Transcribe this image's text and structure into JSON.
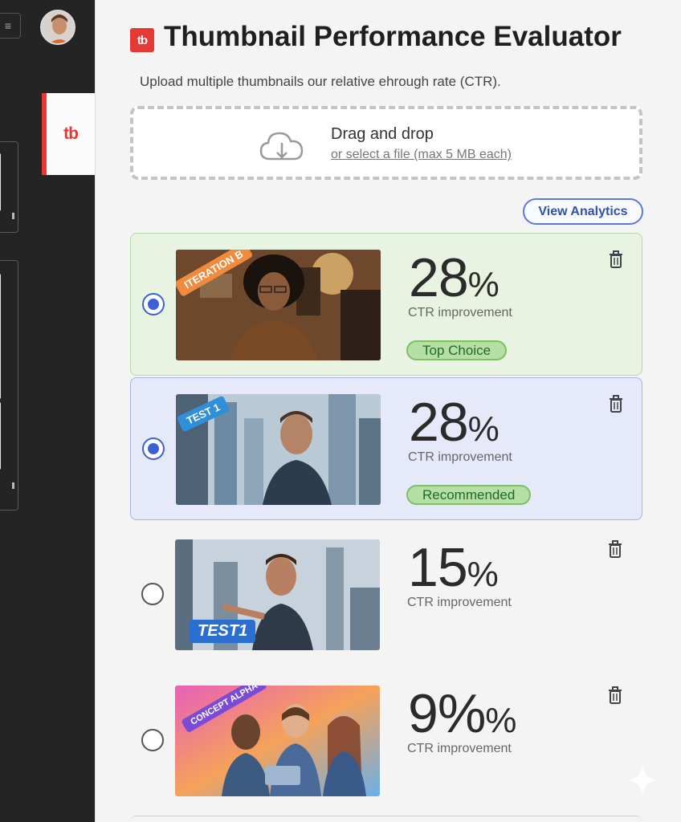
{
  "app": {
    "title": "Thumbnail Performance Evaluator",
    "logo_text": "tb",
    "subtitle": "Upload multiple thumbnails our relative ehrough rate (CTR).",
    "side_tab_logo": "tb",
    "menu_icon": "≡"
  },
  "dropzone": {
    "title": "Drag and drop",
    "subtitle": "or select a file (max 5 MB each)",
    "icon": "cloud-upload-icon"
  },
  "analytics_button": {
    "label": "View Analytics"
  },
  "thumbnails": [
    {
      "tag": "ITERATION B",
      "tag_color": "#f08a3c",
      "value": "28",
      "unit": "%",
      "label": "CTR improvement",
      "badge": "Top Choice",
      "selected": true,
      "style": "green"
    },
    {
      "tag": "TEST 1",
      "tag_color": "#2f8fd8",
      "value": "28",
      "unit": "%",
      "label": "CTR improvement",
      "badge": "Recommended",
      "selected": true,
      "style": "blue"
    },
    {
      "tag": "TEST1",
      "tag_color": "#2a6fd0",
      "value": "15",
      "unit": "%",
      "label": "CTR improvement",
      "badge": "",
      "selected": false,
      "style": "plain"
    },
    {
      "tag": "CONCEPT ALPHA",
      "tag_color": "#7b4bd6",
      "value": "9%",
      "unit": "%",
      "label": "CTR improvement",
      "badge": "",
      "selected": false,
      "style": "plain"
    }
  ],
  "colors": {
    "accent": "#e53935",
    "primary": "#3f5fd6",
    "top_choice_bg": "#e8f3e1",
    "recommended_bg": "#e6e9f9",
    "badge_green": "#b5dfa5"
  }
}
